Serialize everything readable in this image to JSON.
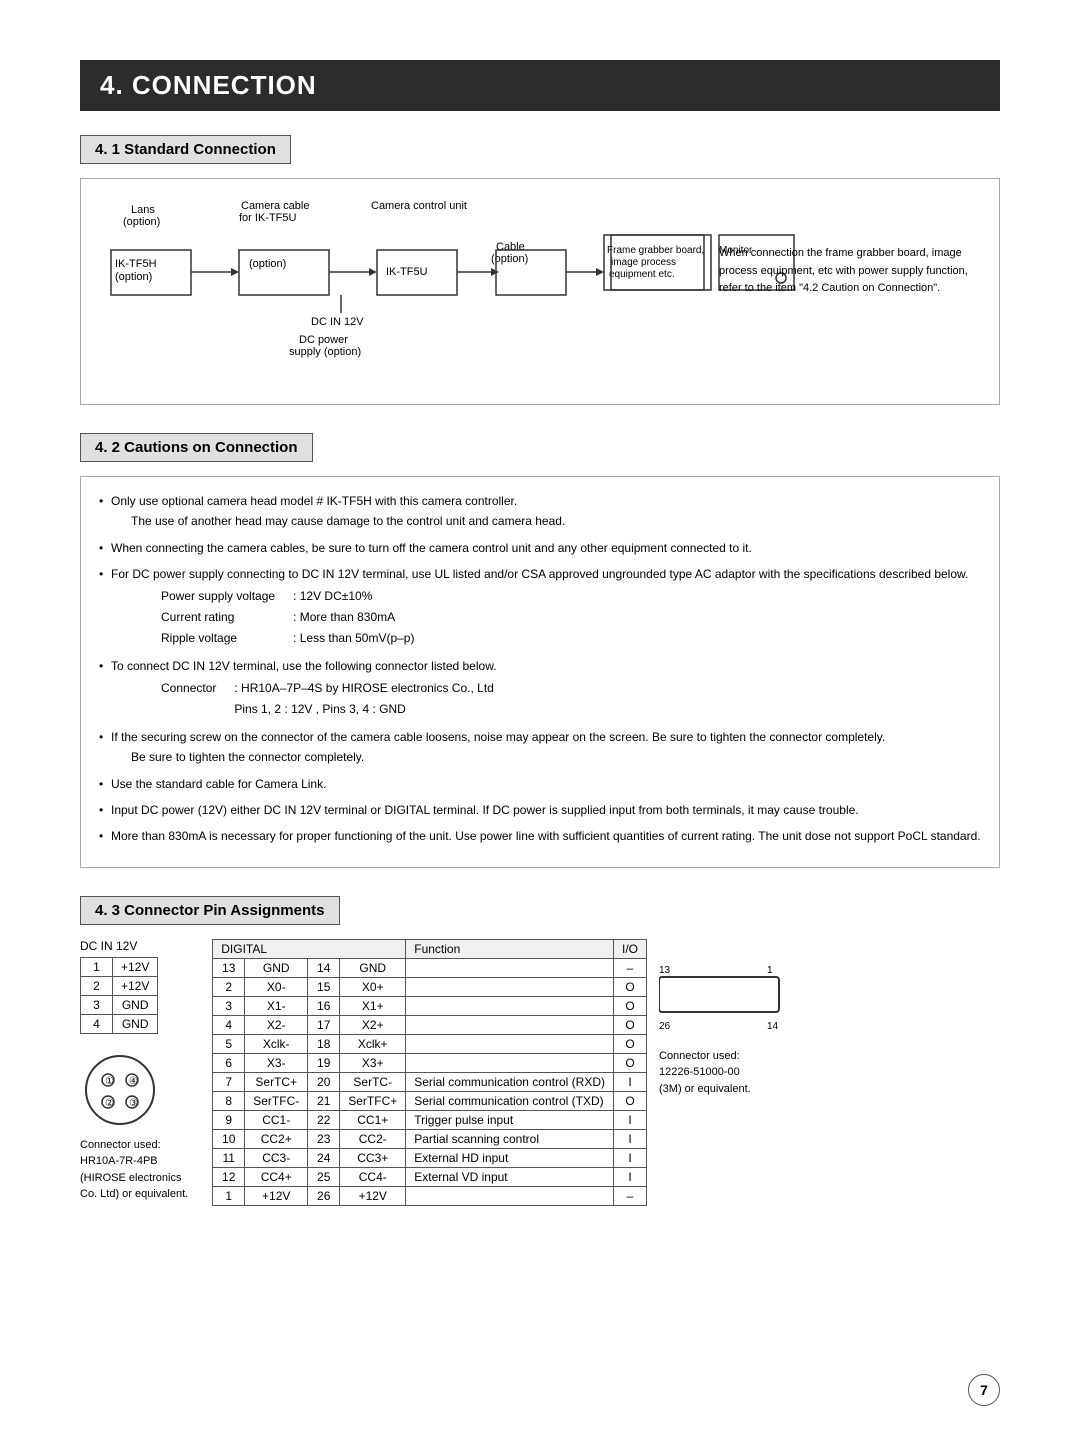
{
  "main_title": "4. CONNECTION",
  "section1": {
    "heading": "4. 1   Standard Connection",
    "diagram": {
      "labels": {
        "lans": "Lans\n(option)",
        "camera_cable": "Camera cable\nfor IK-TF5U",
        "camera_control_unit": "Camera control unit",
        "option1": "(option)",
        "ik_tf5u": "IK-TF5U",
        "ik_tf5h": "IK-TF5H\n(option)",
        "dc_in_12v": "DC IN 12V",
        "dc_power": "DC power\nsupply (option)",
        "cable": "Cable\n(option)",
        "frame_grabber": "Frame grabber board,\nimage process\nequipment etc.",
        "monitor": "Monitor"
      },
      "right_text": "When connection the frame grabber board, image process equipment, etc with power supply function, refer to the item \"4.2 Caution on Connection\"."
    }
  },
  "section2": {
    "heading": "4. 2   Cautions on Connection",
    "bullets": [
      {
        "text": "Only use optional camera head model # IK-TF5H with this camera controller.",
        "sub": "The use of another head may cause damage to the control unit and camera head."
      },
      {
        "text": "When connecting the camera cables, be sure to turn off the camera control unit and any other equipment connected to it.",
        "sub": null
      },
      {
        "text": "For DC power supply connecting to DC IN 12V terminal, use UL listed and/or CSA approved ungrounded type AC adaptor with the specifications described below.",
        "sub": null,
        "specs": [
          [
            "Power supply voltage",
            ": 12V DC±10%"
          ],
          [
            "Current rating",
            ": More than 830mA"
          ],
          [
            "Ripple voltage",
            ": Less than 50mV(p–p)"
          ]
        ]
      },
      {
        "text": "To connect DC IN 12V terminal, use the following connector listed below.",
        "sub": null,
        "connector_specs": [
          [
            "Connector",
            ": HR10A–7P–4S by HIROSE electronics Co., Ltd"
          ],
          [
            "",
            "Pins 1, 2 : 12V ,    Pins 3, 4 : GND"
          ]
        ]
      },
      {
        "text": "If the securing screw on the connector of the camera cable loosens, noise may appear on the screen. Be sure to tighten the connector completely.",
        "sub": null
      },
      {
        "text": "Use the standard cable for Camera Link.",
        "sub": null
      },
      {
        "text": "Input DC power (12V) either DC IN 12V terminal or DIGITAL terminal. If DC power is supplied input from both terminals, it may cause trouble.",
        "sub": null
      },
      {
        "text": "More than 830mA is necessary for proper functioning of the unit. Use power line with sufficient quantities of current rating. The unit dose not support PoCL standard.",
        "sub": null
      }
    ]
  },
  "section3": {
    "heading": "4. 3   Connector Pin Assignments",
    "dc_table": {
      "label": "DC IN 12V",
      "headers": [
        "",
        ""
      ],
      "rows": [
        [
          "1",
          "+12V"
        ],
        [
          "2",
          "+12V"
        ],
        [
          "3",
          "GND"
        ],
        [
          "4",
          "GND"
        ]
      ]
    },
    "digital_table": {
      "label": "DIGITAL",
      "function_label": "Function",
      "io_label": "I/O",
      "rows": [
        [
          "13",
          "GND",
          "14",
          "GND",
          "",
          "–"
        ],
        [
          "2",
          "X0-",
          "15",
          "X0+",
          "",
          "O"
        ],
        [
          "3",
          "X1-",
          "16",
          "X1+",
          "",
          "O"
        ],
        [
          "4",
          "X2-",
          "17",
          "X2+",
          "",
          "O"
        ],
        [
          "5",
          "Xclk-",
          "18",
          "Xclk+",
          "",
          "O"
        ],
        [
          "6",
          "X3-",
          "19",
          "X3+",
          "",
          "O"
        ],
        [
          "7",
          "SerTC+",
          "20",
          "SerTC-",
          "Serial communication control (RXD)",
          "I"
        ],
        [
          "8",
          "SerTFC-",
          "21",
          "SerTFC+",
          "Serial communication control (TXD)",
          "O"
        ],
        [
          "9",
          "CC1-",
          "22",
          "CC1+",
          "Trigger pulse input",
          "I"
        ],
        [
          "10",
          "CC2+",
          "23",
          "CC2-",
          "Partial scanning control",
          "I"
        ],
        [
          "11",
          "CC3-",
          "24",
          "CC3+",
          "External HD input",
          "I"
        ],
        [
          "12",
          "CC4+",
          "25",
          "CC4-",
          "External VD input",
          "I"
        ],
        [
          "1",
          "+12V",
          "26",
          "+12V",
          "",
          "–"
        ]
      ]
    },
    "dc_connector": {
      "label": "Connector used:\nHR10A-7R-4PB\n(HIROSE electronics\nCo. Ltd) or equivalent."
    },
    "digital_connector": {
      "label": "Connector used:\n12226-51000-00\n(3M) or equivalent.",
      "top_nums": "13          1",
      "bottom_nums": "26          14"
    }
  },
  "page_number": "7"
}
